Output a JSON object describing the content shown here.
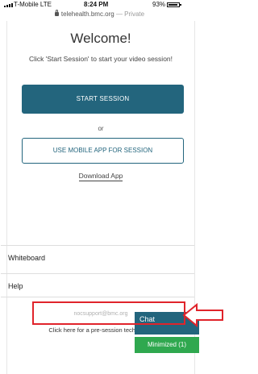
{
  "status_bar": {
    "carrier": "T-Mobile  LTE",
    "time": "8:24 PM",
    "battery": "93%"
  },
  "url_bar": {
    "domain": "telehealth.bmc.org",
    "mode": " — Private"
  },
  "main": {
    "title": "Welcome!",
    "instruction": "Click 'Start Session' to start your video session!",
    "start_button": "START SESSION",
    "or_text": "or",
    "mobile_button": "USE MOBILE APP FOR SESSION",
    "download_link": "Download App"
  },
  "menu": {
    "whiteboard": "Whiteboard",
    "help": "Help"
  },
  "footer": {
    "email": "nocsupport@bmc.org",
    "tech_check": "Click here for a pre-session tech check"
  },
  "chat": {
    "chat_label": "Chat",
    "minimized_label": "Minimized (1)"
  },
  "colors": {
    "accent": "#23657d",
    "minimized": "#2fa84f",
    "highlight": "#e0242b"
  }
}
